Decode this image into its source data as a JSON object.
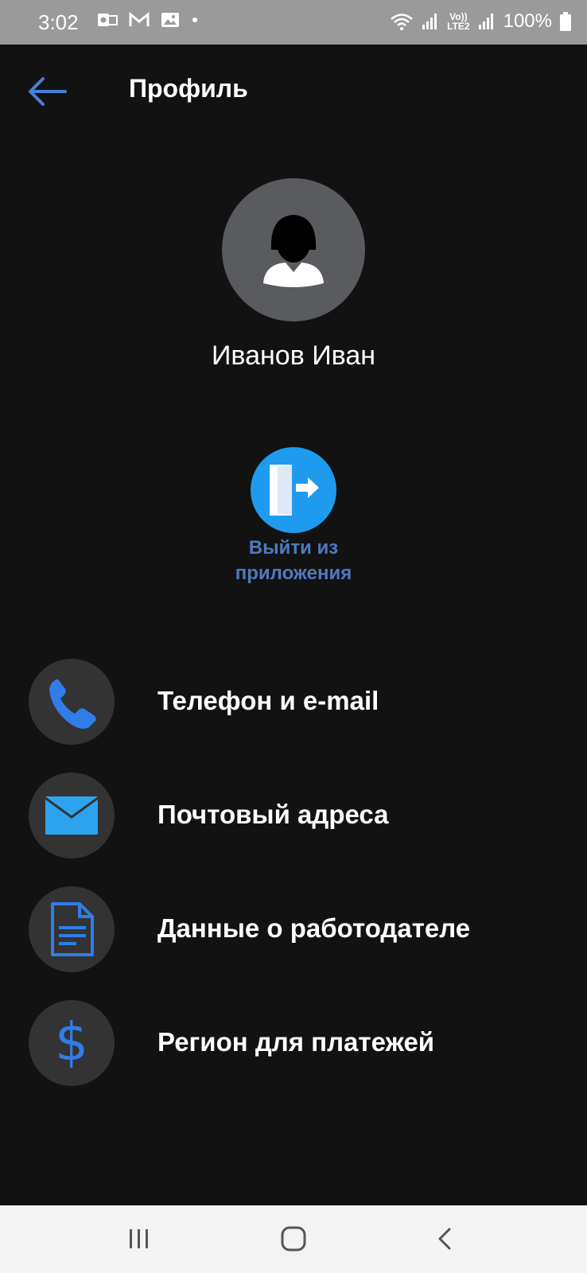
{
  "status_bar": {
    "time": "3:02",
    "battery": "100%",
    "network_label": "LTE2",
    "network_label_top": "Vo))",
    "notification_icons": [
      "outlook-icon",
      "gmail-icon",
      "gallery-icon",
      "dot-icon"
    ]
  },
  "header": {
    "title": "Профиль"
  },
  "profile": {
    "name": "Иванов Иван"
  },
  "logout": {
    "label": "Выйти из приложения"
  },
  "menu": [
    {
      "label": "Телефон и e-mail",
      "icon": "phone-icon"
    },
    {
      "label": "Почтовый адреса",
      "icon": "mail-icon"
    },
    {
      "label": "Данные о работодателе",
      "icon": "document-icon"
    },
    {
      "label": "Регион для платежей",
      "icon": "dollar-icon",
      "glyph": "$"
    }
  ],
  "colors": {
    "background": "#121212",
    "accent_blue": "#1e9bef",
    "link_blue": "#4e79bf",
    "icon_blue": "#2f7ee8",
    "circle_gray": "#333333"
  }
}
